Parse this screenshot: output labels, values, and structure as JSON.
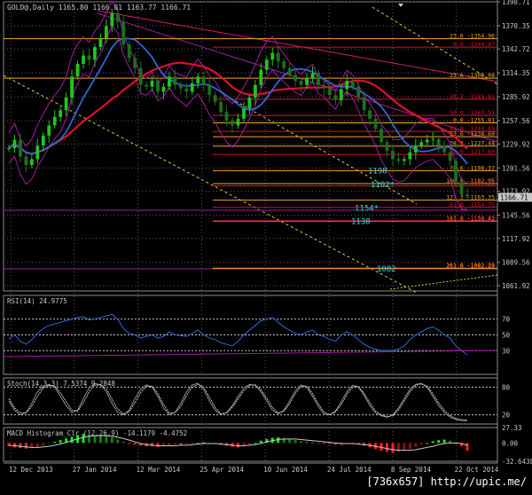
{
  "header": {
    "symbol": "GOLD@,Daily",
    "ohlc": "1165.80 1166.81 1163.77 1166.71"
  },
  "colors": {
    "bg": "#000000",
    "grid": "#5a5a5a",
    "frame": "#8c8c8c",
    "candle_up": "#22c322",
    "candle_down": "#1e6e1e",
    "ma_red": "#e0102a",
    "ma_blue": "#2d68d6",
    "bands": "#a01ea0",
    "fib": "#f5a623",
    "trend_yellow": "#d8d030",
    "pink": "#d0206a",
    "cyan": "#33d6e6"
  },
  "watermark": "[736x657] http://upic.me/",
  "chart_data": [
    {
      "type": "line",
      "name": "price",
      "ylim": [
        1061.92,
        1398.71
      ],
      "y_ticks": [
        "1398.71",
        "1370.35",
        "1342.72",
        "1314.35",
        "1285.92",
        "1257.56",
        "1229.92",
        "1201.56",
        "1173.92",
        "1145.56",
        "1117.92",
        "1089.56",
        "1061.92"
      ],
      "last_price": "1166.71",
      "x_ticks": [
        "12 Dec 2013",
        "27 Jan 2014",
        "12 Mar 2014",
        "25 Apr 2014",
        "10 Jun 2014",
        "24 Jul 2014",
        "8 Sep 2014",
        "22 Oct 2014"
      ],
      "close": [
        1225,
        1235,
        1215,
        1205,
        1212,
        1228,
        1240,
        1252,
        1262,
        1270,
        1285,
        1310,
        1325,
        1335,
        1330,
        1345,
        1355,
        1370,
        1385,
        1375,
        1348,
        1332,
        1320,
        1300,
        1298,
        1305,
        1292,
        1298,
        1310,
        1300,
        1296,
        1292,
        1302,
        1310,
        1300,
        1288,
        1280,
        1268,
        1258,
        1252,
        1260,
        1272,
        1285,
        1300,
        1318,
        1330,
        1338,
        1328,
        1320,
        1312,
        1305,
        1300,
        1308,
        1314,
        1300,
        1296,
        1288,
        1282,
        1295,
        1305,
        1298,
        1285,
        1270,
        1260,
        1248,
        1232,
        1222,
        1212,
        1210,
        1212,
        1220,
        1228,
        1232,
        1235,
        1236,
        1228,
        1220,
        1210,
        1185,
        1170,
        1168
      ],
      "fib_levels": [
        {
          "label": "23.6 -1354.96",
          "value": 1354.96,
          "color": "#f5a623"
        },
        {
          "label": "0.0 -1344.87",
          "value": 1344.87,
          "color": "#e0102a"
        },
        {
          "label": "23.6 -1308.08",
          "value": 1308.08,
          "color": "#f5a623"
        },
        {
          "label": "38.2 -1283.02",
          "value": 1283.02,
          "color": "#e0102a"
        },
        {
          "label": "50.0 -1263.91",
          "value": 1263.91,
          "color": "#e0102a"
        },
        {
          "label": "0.0 -1255.01",
          "value": 1255.01,
          "color": "#f5a623"
        },
        {
          "label": "61.8 -1244.88",
          "value": 1244.88,
          "color": "#e0102a"
        },
        {
          "label": "23.6 -1238.60",
          "value": 1238.6,
          "color": "#f5a623"
        },
        {
          "label": "38.2 -1227.48",
          "value": 1227.48,
          "color": "#f5a623"
        },
        {
          "label": "78.6 -1217.60",
          "value": 1217.6,
          "color": "#e0102a"
        },
        {
          "label": "78.6 -1198.37",
          "value": 1198.37,
          "color": "#f5a623"
        },
        {
          "label": "100.0 -1182.95",
          "value": 1182.95,
          "color": "#f5a623"
        },
        {
          "label": "0.0 -1180.35",
          "value": 1180.35,
          "color": "#e0102a"
        },
        {
          "label": "127.2 -1163.35",
          "value": 1163.35,
          "color": "#f5a623"
        },
        {
          "label": "61.8 -1154.75",
          "value": 1154.75,
          "color": "#e0102a"
        },
        {
          "label": "161.8 -1138.42",
          "value": 1138.42,
          "color": "#f5a623"
        },
        {
          "label": "127.2 -1138.91",
          "value": 1138.91,
          "color": "#e0102a"
        },
        {
          "label": "161.8 -1082.88",
          "value": 1082.88,
          "color": "#e0102a"
        },
        {
          "label": "261.8 -1082.28",
          "value": 1082.28,
          "color": "#f5a623"
        }
      ],
      "annotations": [
        {
          "text": "1198",
          "value": 1198
        },
        {
          "text": "1182*",
          "value": 1182
        },
        {
          "text": "1154*",
          "value": 1154
        },
        {
          "text": "1138",
          "value": 1138
        },
        {
          "text": "1082",
          "value": 1082
        }
      ]
    },
    {
      "type": "line",
      "name": "RSI",
      "title": "RSI(14) 24.9775",
      "ylim": [
        0,
        100
      ],
      "levels": [
        70,
        50,
        30
      ],
      "y_ticks": [
        "70",
        "50",
        "30"
      ],
      "values": [
        45,
        50,
        42,
        38,
        44,
        52,
        58,
        62,
        64,
        66,
        68,
        70,
        72,
        73,
        69,
        70,
        72,
        74,
        76,
        70,
        58,
        52,
        50,
        46,
        48,
        50,
        46,
        48,
        54,
        50,
        49,
        48,
        52,
        56,
        50,
        46,
        44,
        40,
        38,
        36,
        42,
        50,
        56,
        62,
        68,
        70,
        72,
        66,
        60,
        56,
        52,
        50,
        54,
        56,
        50,
        48,
        44,
        42,
        50,
        54,
        50,
        44,
        38,
        34,
        32,
        30,
        30,
        30,
        32,
        36,
        44,
        50,
        54,
        58,
        60,
        56,
        50,
        46,
        36,
        30,
        25
      ]
    },
    {
      "type": "line",
      "name": "Stochastic",
      "title": "Stoch(14,3,3) 7.5374 9.2848",
      "ylim": [
        0,
        100
      ],
      "levels": [
        80,
        20
      ],
      "y_ticks": [
        "80",
        "20"
      ],
      "values": [
        50,
        30,
        20,
        25,
        45,
        70,
        82,
        86,
        80,
        60,
        40,
        25,
        30,
        55,
        78,
        88,
        85,
        70,
        45,
        25,
        20,
        30,
        55,
        75,
        85,
        80,
        60,
        35,
        20,
        25,
        45,
        70,
        85,
        88,
        75,
        50,
        30,
        20,
        25,
        40,
        60,
        78,
        86,
        84,
        70,
        50,
        30,
        22,
        30,
        50,
        72,
        85,
        80,
        60,
        38,
        22,
        20,
        28,
        48,
        70,
        84,
        80,
        62,
        40,
        24,
        18,
        15,
        20,
        35,
        55,
        75,
        86,
        88,
        80,
        60,
        40,
        25,
        15,
        10,
        8,
        7
      ],
      "values2": [
        55,
        35,
        24,
        24,
        38,
        60,
        78,
        84,
        82,
        68,
        48,
        30,
        28,
        46,
        70,
        84,
        86,
        76,
        54,
        32,
        22,
        26,
        46,
        68,
        82,
        82,
        66,
        42,
        24,
        24,
        38,
        62,
        80,
        86,
        80,
        58,
        36,
        22,
        24,
        36,
        54,
        72,
        84,
        85,
        74,
        56,
        36,
        24,
        28,
        44,
        66,
        82,
        82,
        66,
        44,
        26,
        20,
        26,
        42,
        64,
        80,
        82,
        66,
        46,
        28,
        20,
        16,
        18,
        30,
        50,
        70,
        84,
        87,
        82,
        66,
        46,
        30,
        18,
        12,
        9,
        9
      ]
    },
    {
      "type": "bar",
      "name": "MACD",
      "title": "MACD Histogram_Clr (12,26,9) -14.1179 -4.4752",
      "ylim": [
        -32.6438,
        27.33
      ],
      "y_ticks": [
        "27.33",
        "0.00",
        "-32.6438"
      ],
      "values": [
        -6,
        -8,
        -9,
        -10,
        -9,
        -7,
        -4,
        -1,
        2,
        5,
        8,
        11,
        14,
        16,
        15,
        14,
        13,
        12,
        10,
        6,
        2,
        -1,
        -3,
        -5,
        -6,
        -6,
        -7,
        -6,
        -4,
        -3,
        -3,
        -2,
        -1,
        0,
        1,
        0,
        -1,
        -3,
        -5,
        -7,
        -8,
        -6,
        -3,
        0,
        4,
        7,
        9,
        10,
        9,
        7,
        5,
        3,
        2,
        1,
        0,
        -1,
        -2,
        -3,
        -3,
        -2,
        -2,
        -3,
        -5,
        -8,
        -11,
        -14,
        -16,
        -17,
        -16,
        -14,
        -11,
        -7,
        -3,
        0,
        3,
        5,
        6,
        4,
        0,
        -6,
        -14
      ],
      "signal": [
        -4,
        -5,
        -6,
        -7,
        -8,
        -8,
        -7,
        -6,
        -4,
        -2,
        1,
        4,
        7,
        10,
        12,
        13,
        13,
        13,
        12,
        10,
        8,
        5,
        2,
        -1,
        -3,
        -4,
        -5,
        -5,
        -5,
        -5,
        -4,
        -4,
        -3,
        -2,
        -1,
        -1,
        -1,
        -2,
        -3,
        -4,
        -5,
        -5,
        -4,
        -3,
        -1,
        2,
        4,
        6,
        7,
        7,
        7,
        6,
        5,
        4,
        3,
        2,
        1,
        0,
        -1,
        -1,
        -1,
        -2,
        -3,
        -4,
        -6,
        -8,
        -10,
        -12,
        -13,
        -13,
        -13,
        -12,
        -10,
        -8,
        -6,
        -3,
        -1,
        0,
        0,
        -1,
        -4
      ]
    }
  ]
}
